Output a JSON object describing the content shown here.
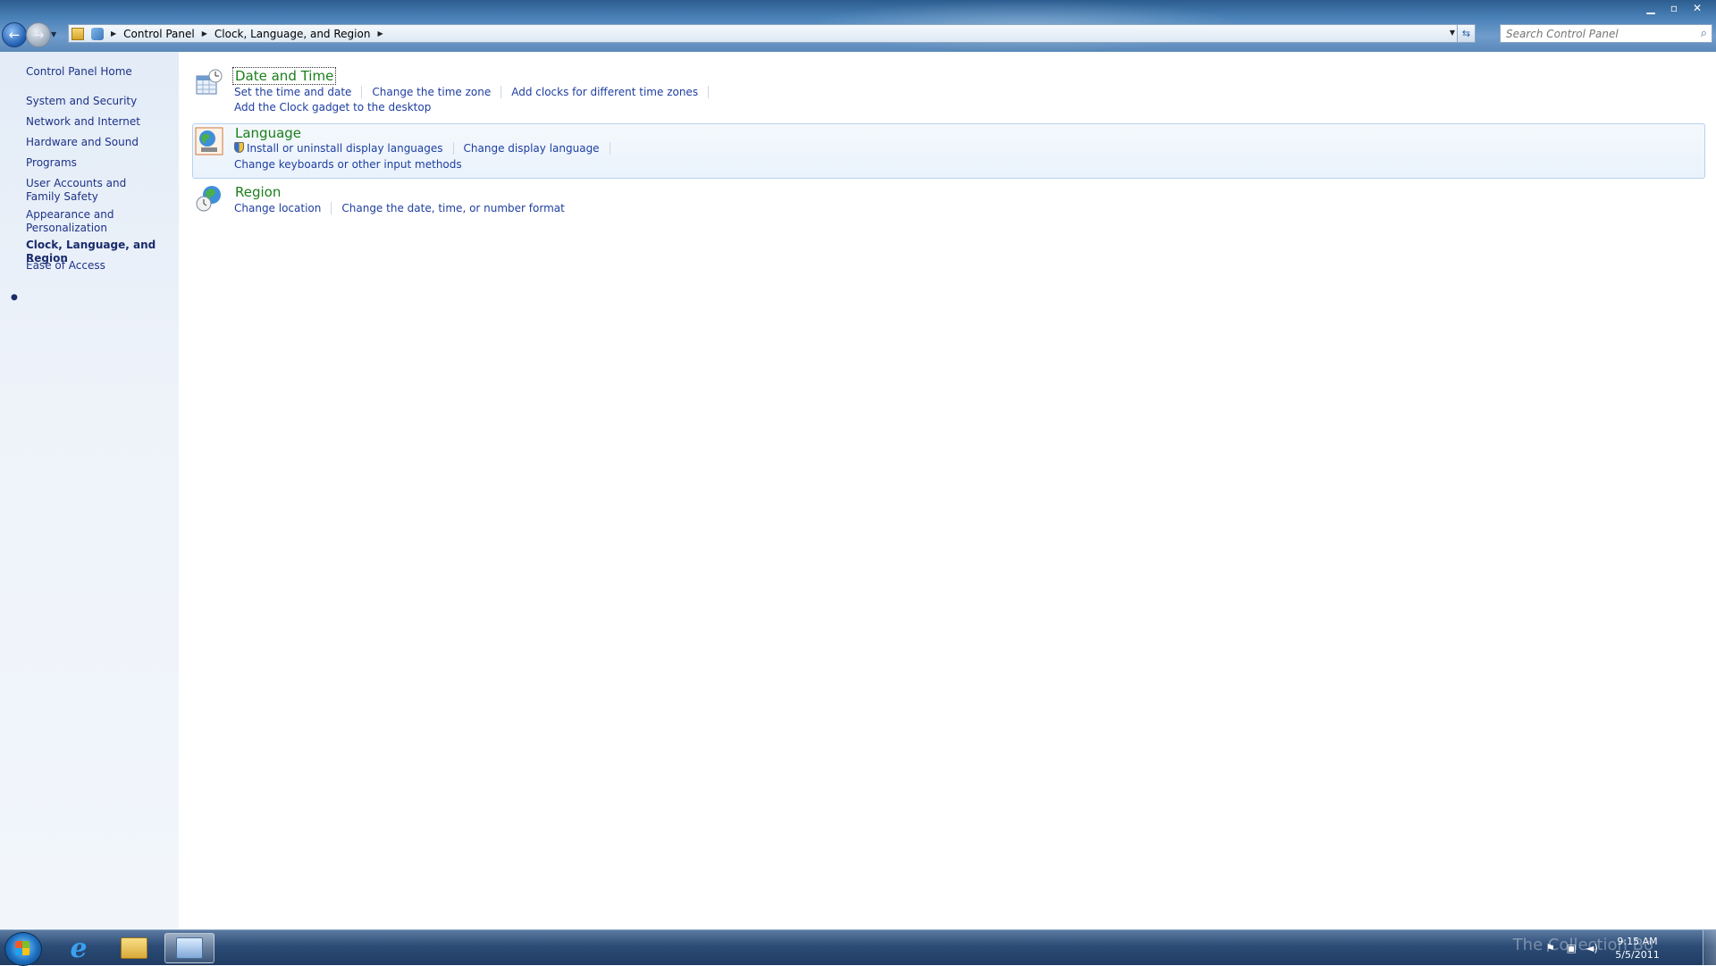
{
  "window": {
    "buttons": {
      "minimize": "▁",
      "maximize": "▫",
      "close": "✕"
    }
  },
  "navigation": {
    "breadcrumb": [
      "Control Panel",
      "Clock, Language, and Region"
    ],
    "search_placeholder": "Search Control Panel"
  },
  "sidebar": {
    "items": [
      {
        "label": "Control Panel Home",
        "current": false
      },
      {
        "label": "System and Security",
        "current": false
      },
      {
        "label": "Network and Internet",
        "current": false
      },
      {
        "label": "Hardware and Sound",
        "current": false
      },
      {
        "label": "Programs",
        "current": false
      },
      {
        "label": "User Accounts and Family Safety",
        "current": false
      },
      {
        "label": "Appearance and Personalization",
        "current": false
      },
      {
        "label": "Clock, Language, and Region",
        "current": true
      },
      {
        "label": "Ease of Access",
        "current": false
      }
    ]
  },
  "categories": [
    {
      "title": "Date and Time",
      "icon": "calendar-clock-icon",
      "links_row1": [
        "Set the time and date",
        "Change the time zone",
        "Add clocks for different time zones"
      ],
      "links_row2": [
        "Add the Clock gadget to the desktop"
      ]
    },
    {
      "title": "Language",
      "icon": "globe-language-icon",
      "links_row1": [
        "Install or uninstall display languages",
        "Change display language"
      ],
      "links_row2": [
        "Change keyboards or other input methods"
      ]
    },
    {
      "title": "Region",
      "icon": "globe-clock-icon",
      "links_row1": [
        "Change location",
        "Change the date, time, or number format"
      ]
    }
  ],
  "taskbar": {
    "time": "9:15 AM",
    "date": "5/5/2011",
    "watermark": "The Collection Bo"
  },
  "colors": {
    "category_title": "#1a7f1a",
    "link": "#1e3ea0",
    "sidebar_bg": "#e3ecf7"
  }
}
